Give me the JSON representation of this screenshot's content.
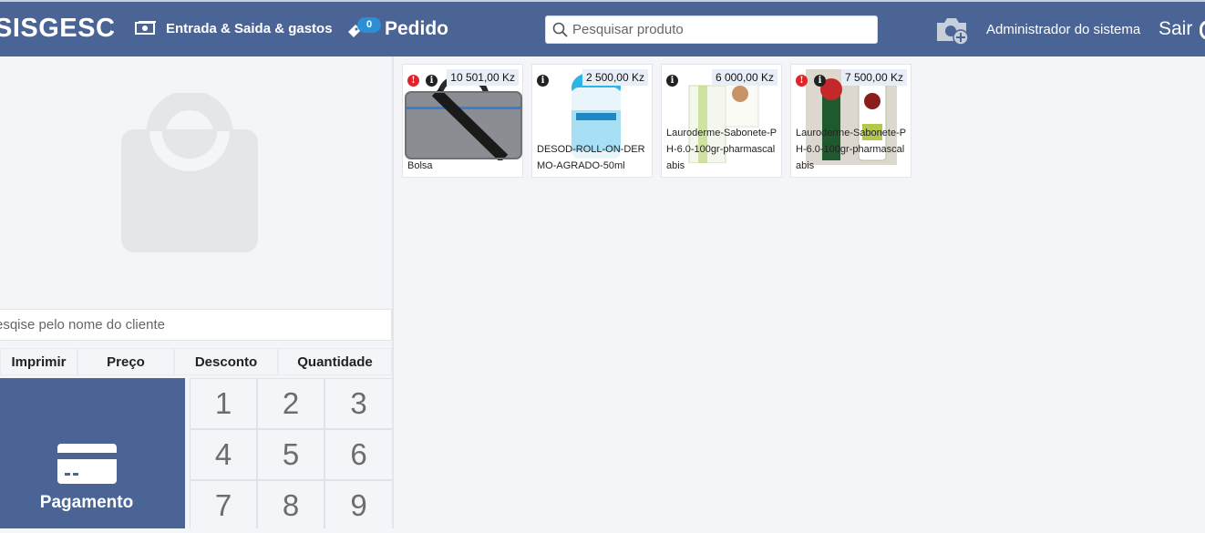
{
  "header": {
    "brand": "SISGESC",
    "entrada_label": "Entrada & Saida & gastos",
    "pedido_label": "Pedido",
    "pedido_count": "0",
    "search_placeholder": "Pesquisar produto",
    "user_name": "Administrador do sistema",
    "logout_label": "Sair"
  },
  "left_panel": {
    "client_placeholder": "esqise pelo nome do cliente",
    "tabs": [
      "Imprimir",
      "Preço",
      "Desconto",
      "Quantidade"
    ],
    "payment_label": "Pagamento",
    "keys": [
      "1",
      "2",
      "3",
      "4",
      "5",
      "6",
      "7",
      "8",
      "9"
    ]
  },
  "products": [
    {
      "name": "Bolsa",
      "price": "10 501,00 Kz",
      "warning": true
    },
    {
      "name": "DESOD-ROLL-ON-DERMO-AGRADO-50ml",
      "price": "2 500,00 Kz",
      "warning": false
    },
    {
      "name": "Lauroderme-Sabonete-PH-6.0-100gr-pharmascalabis",
      "price": "6 000,00 Kz",
      "warning": false
    },
    {
      "name": "Lauroderme-Sabonete-PH-6.0-100gr-pharmascalabis",
      "price": "7 500,00 Kz",
      "warning": true
    }
  ],
  "colors": {
    "primary": "#4a6595",
    "badge": "#2b8fd6",
    "warning": "#e0242a"
  }
}
